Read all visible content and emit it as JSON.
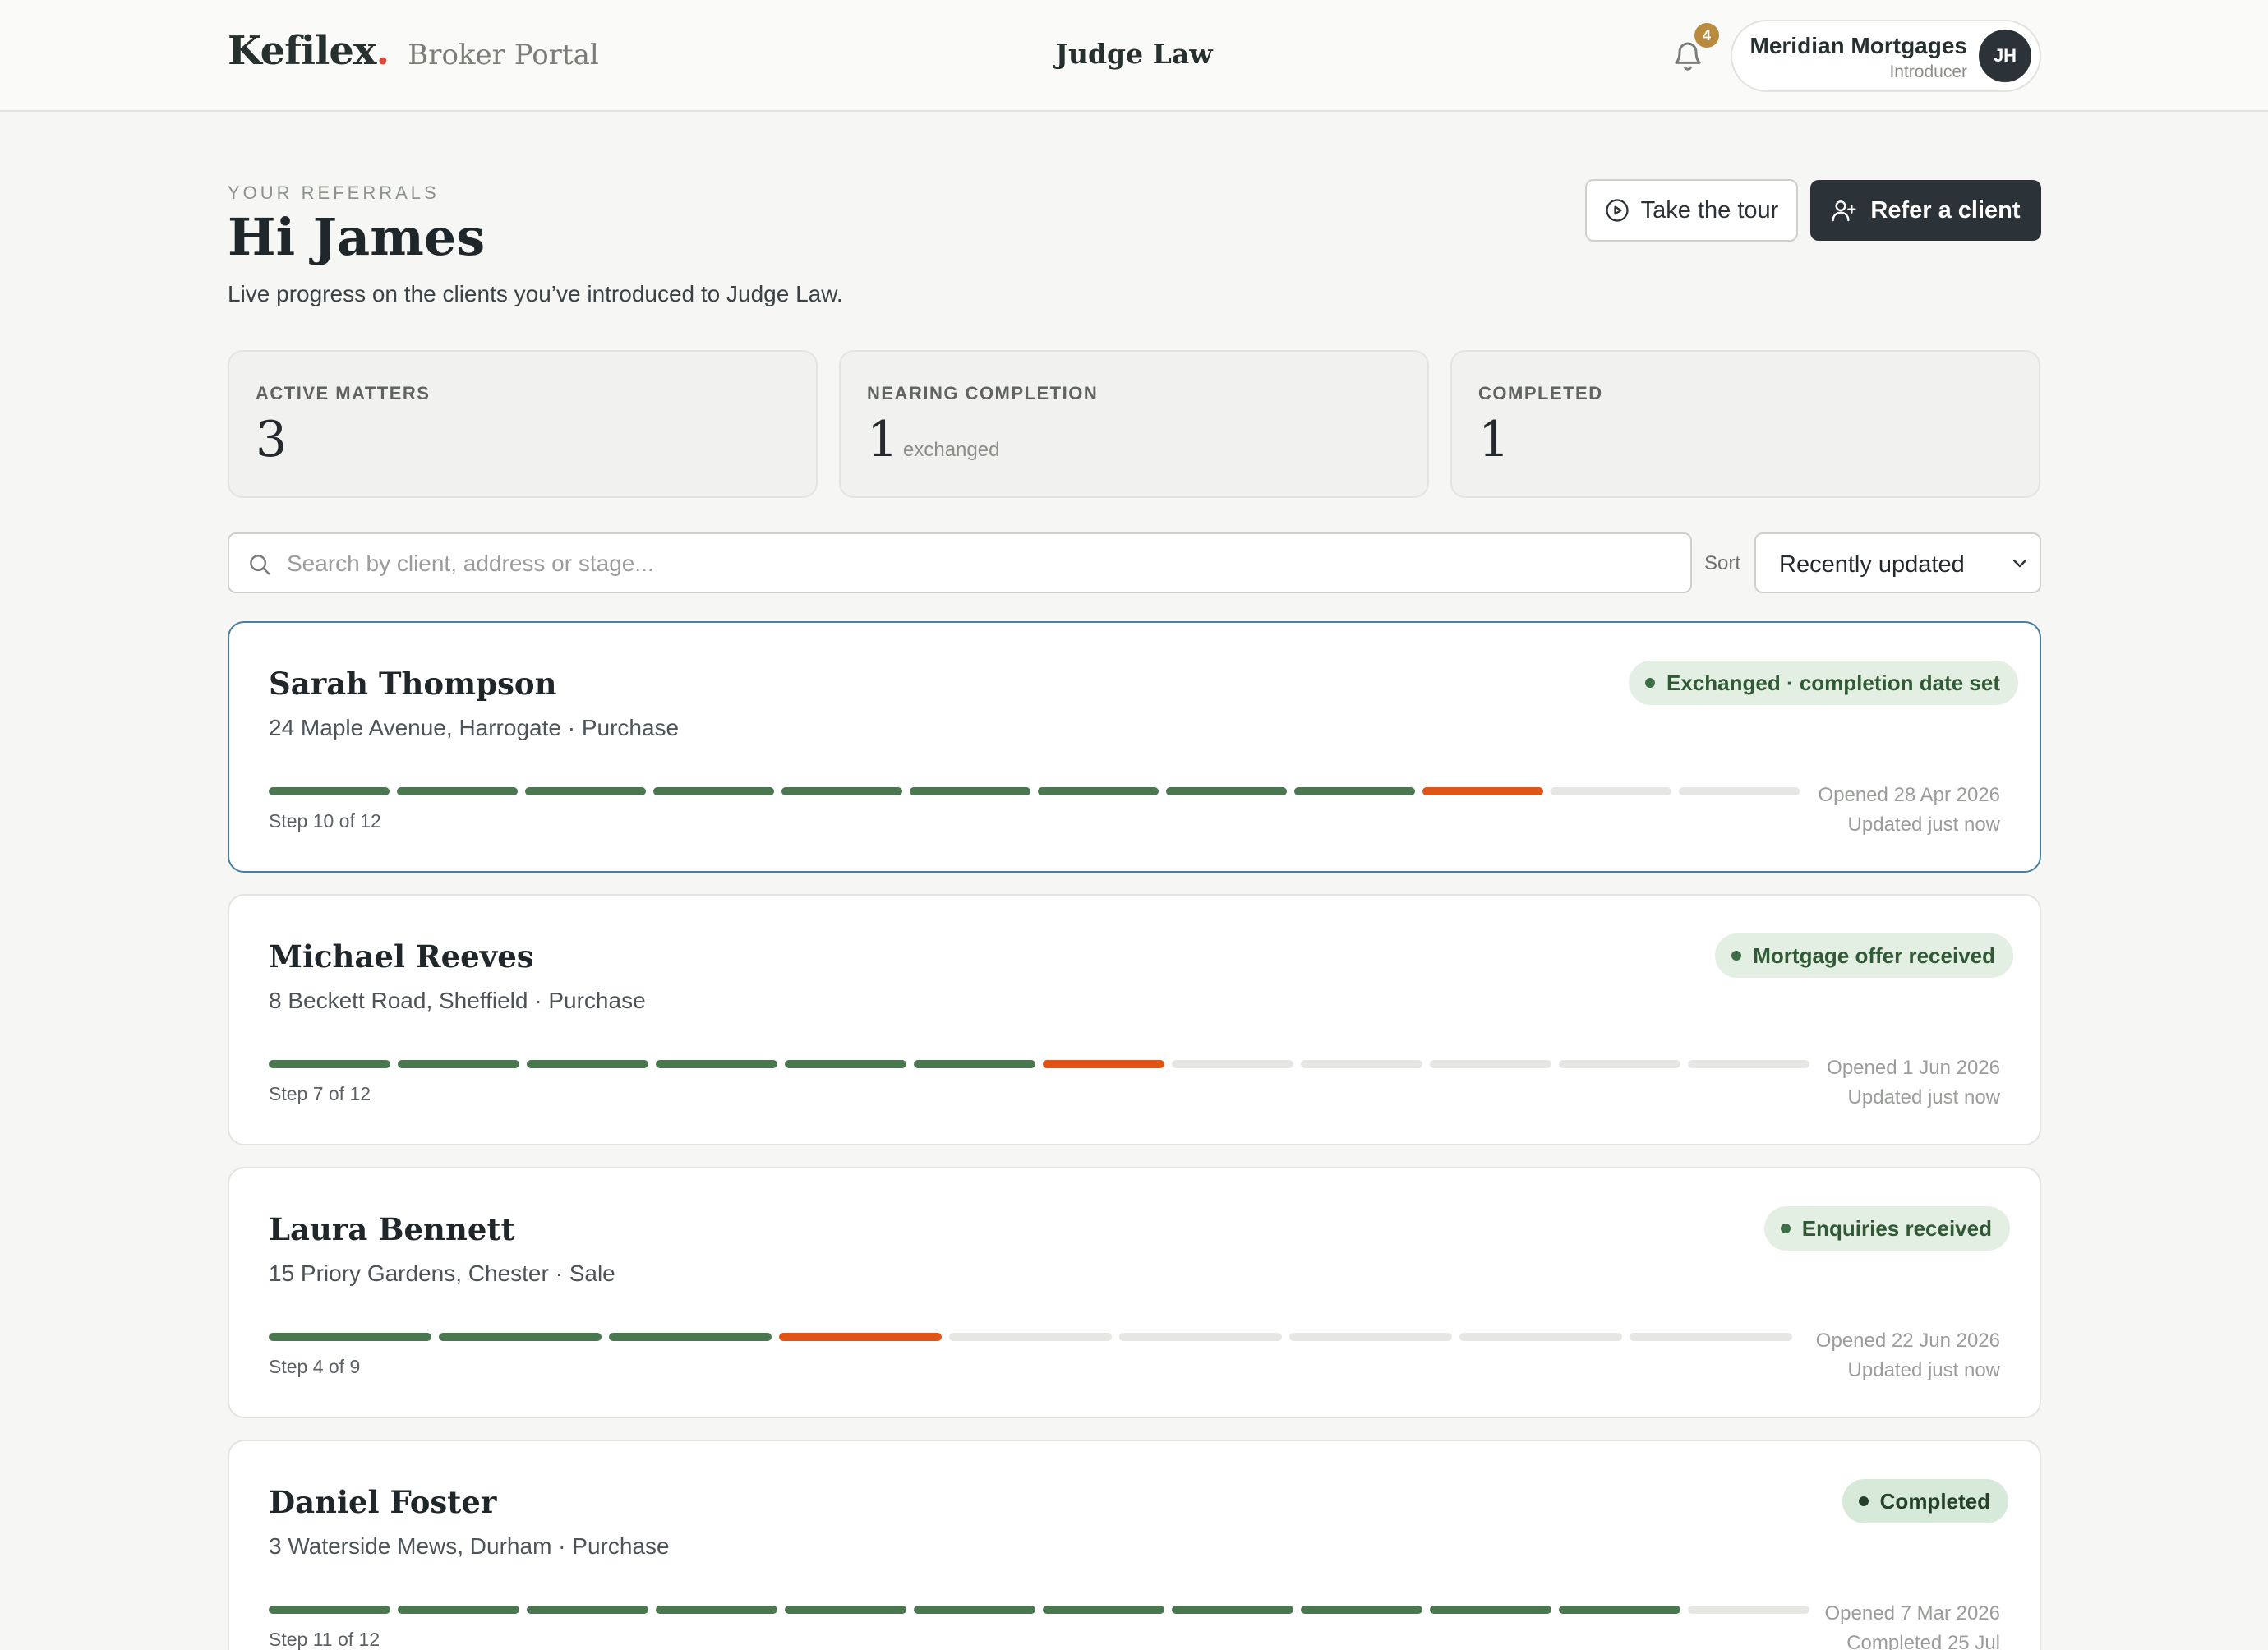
{
  "header": {
    "brand": "Kefilex",
    "brand_dot": ".",
    "portal": "Broker Portal",
    "firm": "Judge Law",
    "notification_count": "4",
    "account_name": "Meridian Mortgages",
    "account_role": "Introducer",
    "avatar_initials": "JH"
  },
  "hero": {
    "eyebrow": "YOUR REFERRALS",
    "greeting": "Hi James",
    "subtitle": "Live progress on the clients you’ve introduced to Judge Law.",
    "tour_label": "Take the tour",
    "refer_label": "Refer a client"
  },
  "stats": [
    {
      "label": "ACTIVE MATTERS",
      "value": "3",
      "note": ""
    },
    {
      "label": "NEARING COMPLETION",
      "value": "1",
      "note": "exchanged"
    },
    {
      "label": "COMPLETED",
      "value": "1",
      "note": ""
    }
  ],
  "search": {
    "placeholder": "Search by client, address or stage...",
    "value": "",
    "sort_label": "Sort",
    "sort_value": "Recently updated"
  },
  "colors": {
    "step_done": "#4a774f",
    "step_current": "#e05418",
    "step_todo": "#e6e6e3",
    "primary_button": "#2b3338",
    "active_card_border": "#4a7fa0"
  },
  "referrals": [
    {
      "client": "Sarah Thompson",
      "address": "24 Maple Avenue, Harrogate",
      "type": "Purchase",
      "status": "Exchanged · completion date set",
      "step_current": 10,
      "step_total": 12,
      "step_text": "Step 10 of 12",
      "meta_1": "Opened 28 Apr 2026",
      "meta_2": "Updated just now",
      "selected": true
    },
    {
      "client": "Michael Reeves",
      "address": "8 Beckett Road, Sheffield",
      "type": "Purchase",
      "status": "Mortgage offer received",
      "step_current": 7,
      "step_total": 12,
      "step_text": "Step 7 of 12",
      "meta_1": "Opened 1 Jun 2026",
      "meta_2": "Updated just now",
      "selected": false
    },
    {
      "client": "Laura Bennett",
      "address": "15 Priory Gardens, Chester",
      "type": "Sale",
      "status": "Enquiries received",
      "step_current": 4,
      "step_total": 9,
      "step_text": "Step 4 of 9",
      "meta_1": "Opened 22 Jun 2026",
      "meta_2": "Updated just now",
      "selected": false
    },
    {
      "client": "Daniel Foster",
      "address": "3 Waterside Mews, Durham",
      "type": "Purchase",
      "status": "Completed",
      "step_current": 11,
      "step_total": 12,
      "completed": true,
      "step_text": "Step 11 of 12",
      "meta_1": "Opened 7 Mar 2026",
      "meta_2": "Completed 25 Jul",
      "selected": false
    }
  ]
}
